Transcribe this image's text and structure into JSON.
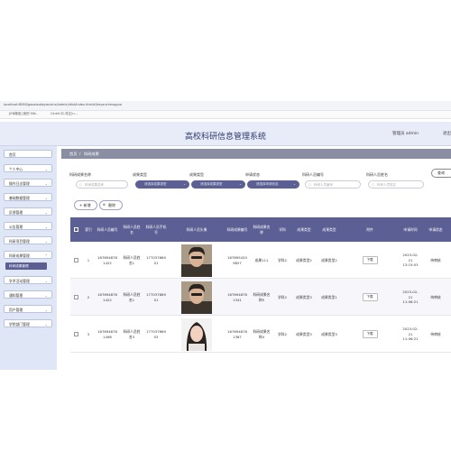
{
  "browser": {
    "url": "localhost:8080/gaoxiaokeyanxinxi/admin/dist/index.html#/keyanchengguo",
    "bookmarks": [
      "[EN微信] 我的 SW...",
      "CineV-中-非正(n..."
    ]
  },
  "header": {
    "title": "高校科研信息管理系统",
    "admin_label": "管理员 admin",
    "exit_label": "退出"
  },
  "sidebar": {
    "items": [
      {
        "label": "首页"
      },
      {
        "label": "个人中心"
      },
      {
        "label": "操作日志管理"
      },
      {
        "label": "基础数据管理"
      },
      {
        "label": "反馈管理"
      },
      {
        "label": "公告管理"
      },
      {
        "label": "科研项目管理"
      },
      {
        "label": "科研成果管理"
      },
      {
        "label": "学术活动管理"
      },
      {
        "label": "通知管理"
      },
      {
        "label": "用户管理"
      },
      {
        "label": "学院部门管理"
      }
    ],
    "sub_item": "科研成果管理"
  },
  "breadcrumb": {
    "home": "首页",
    "sep": "/",
    "current": "科研成果"
  },
  "filters": [
    {
      "label": "科研成果名称",
      "placeholder": "科研成果名称",
      "type": "input"
    },
    {
      "label": "成果类型",
      "placeholder": "请选择成果类型",
      "type": "select"
    },
    {
      "label": "成果类型",
      "placeholder": "请选择成果类型",
      "type": "select"
    },
    {
      "label": "申请状态",
      "placeholder": "请选择申请状态",
      "type": "select"
    },
    {
      "label": "科研人员编号",
      "placeholder": "科研人员编号",
      "type": "input"
    },
    {
      "label": "科研人员姓名",
      "placeholder": "科研人员姓名",
      "type": "input"
    }
  ],
  "search_button": "查询",
  "actions": {
    "add": "+ 新增",
    "delete": "删除"
  },
  "table": {
    "headers": [
      "索引",
      "科研人员编号",
      "科研人员姓名",
      "科研人员手机号",
      "科研人员头像",
      "科研成果编号",
      "科研成果名称",
      "学科",
      "成果类型",
      "成果类型",
      "附件",
      "申请时间",
      "申请状态"
    ],
    "rows": [
      {
        "index": "1",
        "staff_no": "1676948781422",
        "staff_name": "科研人员姓名1",
        "phone": "17703786901",
        "avatar": "avatar-male",
        "result_no": "1676954209827",
        "result_name": "成果111",
        "subject": "学科2",
        "type1": "成果类型2",
        "type2": "成果类型2",
        "attachment": "下载",
        "apply_time": "2023-02-21 13:15:53",
        "status": "待审核"
      },
      {
        "index": "2",
        "staff_no": "1676948781422",
        "staff_name": "科研人员姓名1",
        "phone": "17703786901",
        "avatar": "avatar-male",
        "result_no": "1676948781341",
        "result_name": "科研成果名称5",
        "subject": "学科2",
        "type1": "成果类型3",
        "type2": "成果类型1",
        "attachment": "下载",
        "apply_time": "2023-02-21 11:06:21",
        "status": "待审核"
      },
      {
        "index": "3",
        "staff_no": "1676948781498",
        "staff_name": "科研人员姓名3",
        "phone": "17703786903",
        "avatar": "avatar-female",
        "result_no": "1676948781387",
        "result_name": "科研成果名称4",
        "subject": "学科2",
        "type1": "成果类型3",
        "type2": "成果类型3",
        "attachment": "下载",
        "apply_time": "2023-02-21 11:06:21",
        "status": "待审核"
      }
    ]
  },
  "colors": {
    "accent": "#5b5f93",
    "sidebar_bg": "#dfe6f5",
    "header_bg": "#e8ebf8"
  }
}
